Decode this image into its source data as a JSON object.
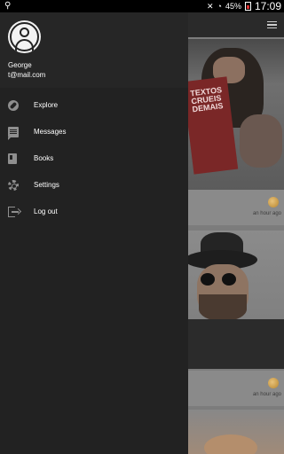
{
  "status_bar": {
    "battery": "45%",
    "time": "17:09"
  },
  "user": {
    "name": "George",
    "email": "t@mail.com"
  },
  "nav": [
    {
      "label": "Explore",
      "icon": "compass-icon"
    },
    {
      "label": "Messages",
      "icon": "message-icon"
    },
    {
      "label": "Books",
      "icon": "book-icon"
    },
    {
      "label": "Settings",
      "icon": "gear-icon"
    },
    {
      "label": "Log out",
      "icon": "logout-icon"
    }
  ],
  "feed": {
    "cards": [
      {
        "time_ago": "an hour ago",
        "book_text": "TEXTOS CRUEIS DEMAIS"
      },
      {
        "time_ago": "an hour ago"
      }
    ]
  }
}
